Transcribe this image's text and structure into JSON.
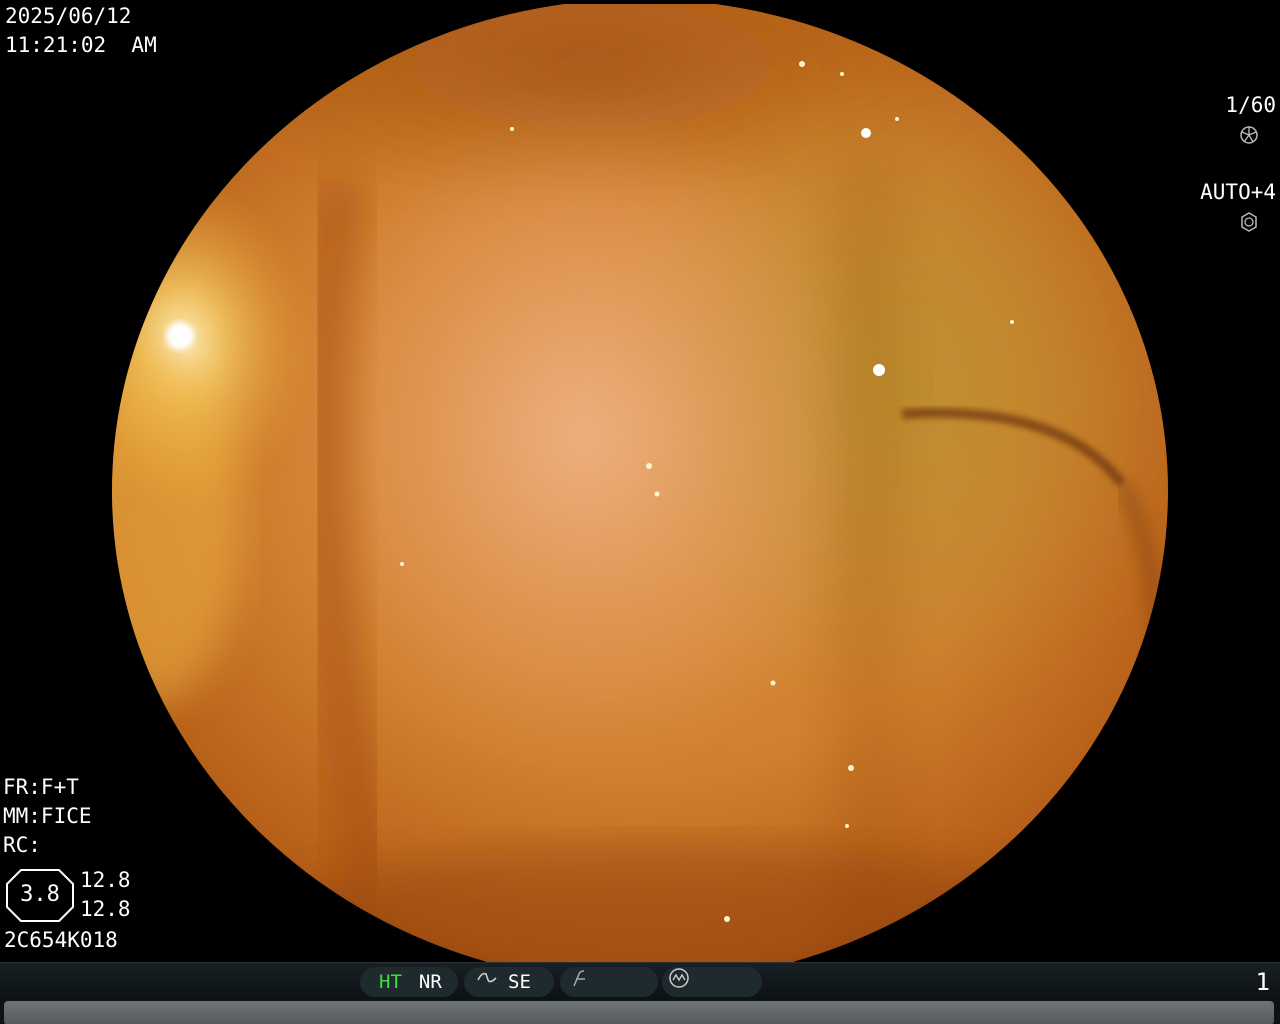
{
  "header": {
    "date": "2025/06/12",
    "time": "11:21:02  AM"
  },
  "exposure": {
    "shutter_icon": "aperture-icon",
    "shutter": "1/60",
    "iris_icon": "iris-icon",
    "iris": "AUTO+4"
  },
  "settings": {
    "fr": "FR:F+T",
    "mm": "MM:FICE",
    "rc": "RC:"
  },
  "zoom": {
    "value": "3.8",
    "scale_top": "12.8",
    "scale_bottom": "12.8"
  },
  "scope_id": "2C654K018",
  "status_bar": {
    "ht": "HT",
    "nr": "NR",
    "se_icon": "sharpness-curve-icon",
    "se": "SE",
    "slash_icon": "contrast-curve-icon",
    "circle_icon": "waveform-circle-icon",
    "page": "1"
  },
  "colors": {
    "ht_active": "#3be03b",
    "bar_bg": "#0d1215",
    "pill_bg": "#1f2a2f"
  }
}
